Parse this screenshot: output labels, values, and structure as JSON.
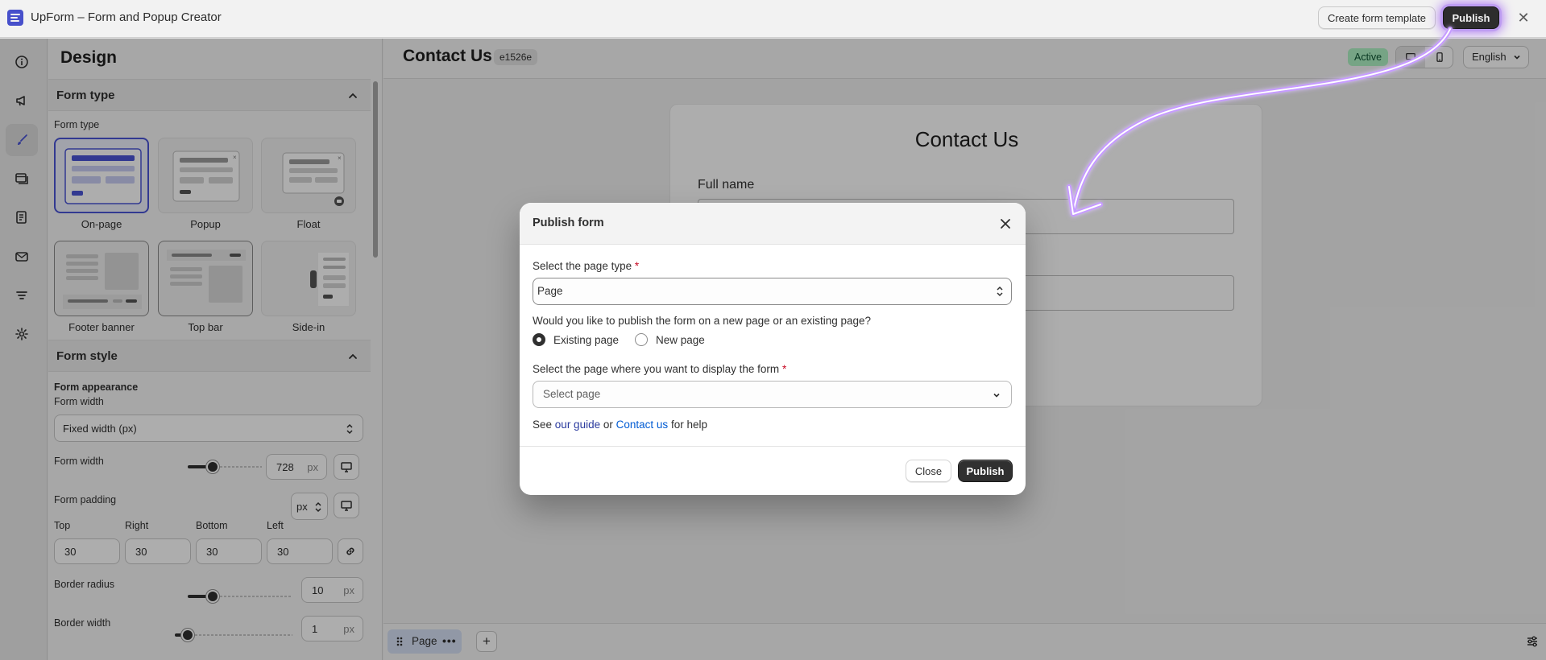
{
  "app": {
    "title": "UpForm – Form and Popup Creator",
    "create_template_label": "Create form template",
    "publish_label": "Publish",
    "close_icon": "close-icon"
  },
  "rail": {
    "items": [
      {
        "icon": "info-icon"
      },
      {
        "icon": "megaphone-icon"
      },
      {
        "icon": "paintbrush-icon"
      },
      {
        "icon": "layers-icon"
      },
      {
        "icon": "form-icon"
      },
      {
        "icon": "mail-icon"
      },
      {
        "icon": "filter-icon"
      },
      {
        "icon": "gear-icon"
      }
    ]
  },
  "sidebar": {
    "title": "Design",
    "form_type_section": {
      "header": "Form type",
      "label": "Form type",
      "types": [
        {
          "label": "On-page"
        },
        {
          "label": "Popup"
        },
        {
          "label": "Float"
        },
        {
          "label": "Footer banner"
        },
        {
          "label": "Top bar"
        },
        {
          "label": "Side-in"
        }
      ]
    },
    "form_style_section": {
      "header": "Form style",
      "appearance_label": "Form appearance",
      "width_label": "Form width",
      "width_mode": "Fixed width (px)",
      "width_field_label": "Form width",
      "width_value": "728",
      "width_unit": "px",
      "padding_label": "Form padding",
      "padding_unit": "px",
      "padding_fields": [
        {
          "label": "Top",
          "value": "30"
        },
        {
          "label": "Right",
          "value": "30"
        },
        {
          "label": "Bottom",
          "value": "30"
        },
        {
          "label": "Left",
          "value": "30"
        }
      ],
      "radius_label": "Border radius",
      "radius_value": "10",
      "radius_unit": "px",
      "border_width_label": "Border width",
      "border_width_value": "1",
      "border_width_unit": "px"
    }
  },
  "canvas": {
    "form_title": "Contact Us",
    "form_id": "e1526e",
    "status": "Active",
    "language": "English",
    "preview": {
      "title": "Contact Us",
      "field_label": "Full name"
    },
    "page_tab_label": "Page",
    "page_tab_more": "•••",
    "add_page": "+"
  },
  "modal": {
    "title": "Publish form",
    "page_type_label": "Select the page type",
    "page_type_value": "Page",
    "publish_question": "Would you like to publish the form on a new page or an existing page?",
    "options": [
      {
        "label": "Existing page",
        "selected": true
      },
      {
        "label": "New page",
        "selected": false
      }
    ],
    "target_page_label": "Select the page where you want to display the form",
    "target_page_placeholder": "Select page",
    "required_mark": "*",
    "help_prefix": "See",
    "help_guide": "our guide",
    "help_or": "or",
    "help_contact": "Contact us",
    "help_suffix": "for help",
    "close_label": "Close",
    "publish_label": "Publish"
  },
  "colors": {
    "accent": "#4b55d6",
    "primary_button": "#303030",
    "active_badge": "#aff2c4",
    "link": "#005bd3",
    "annotation": "#b57bff"
  }
}
